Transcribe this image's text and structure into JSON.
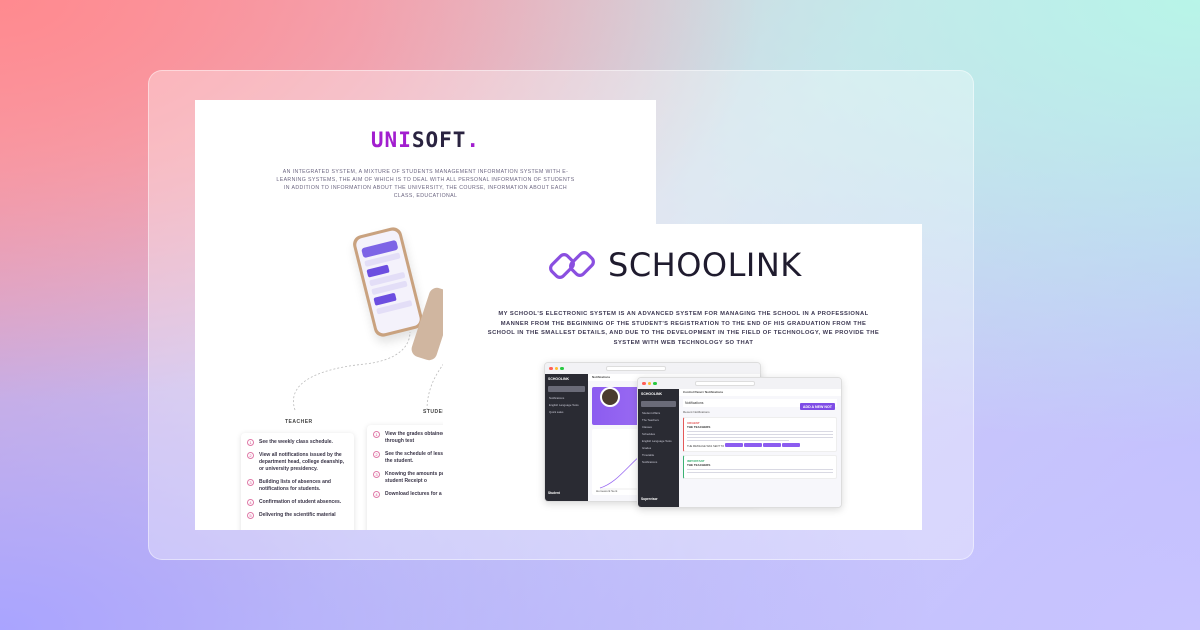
{
  "unisoft": {
    "logo_uni": "UNI",
    "logo_soft": "SOFT",
    "logo_dot": ".",
    "description": "An integrated system, a mixture of students management information system with e-learning systems, the aim of which is to deal with all personal information of students in addition to information about the university, the course, information about each class, educational",
    "teacher_label": "TEACHER",
    "student_label": "STUDENT",
    "teacher_items": [
      "See the weekly class schedule.",
      "View all notifications issued by the department head, college deanship, or university presidency.",
      "Building lists of absences and notifications for students.",
      "Confirmation of student absences.",
      "Delivering the scientific material"
    ],
    "student_items": [
      "View the grades obtained in evaluations through test",
      "See the schedule of lessons belong to the student.",
      "Knowing the amounts paid by the student Receipt o",
      "Download lectures for a"
    ]
  },
  "schoolink": {
    "logo_text": "SCHOOLINK",
    "description": "My school's electronic system is an advanced system for managing the school in a professional manner from the beginning of the student's registration to the end of his graduation from the school in the smallest details, and due to the development in the field of technology, we provide the system with web technology so that",
    "win1": {
      "brand": "SCHOOLINK",
      "header": "Notifications",
      "side_items": [
        "Notifications",
        "English Language Tests",
        "Quick sales"
      ],
      "footer": "Student",
      "graph_label": "Homework Sent",
      "mini_label": "Learn Percentage"
    },
    "win2": {
      "brand": "SCHOOLINK",
      "breadcrumb": "Control Panel  /  Notifications",
      "section_title": "Notifications",
      "recent_label": "Recent Notifications",
      "new_button": "ADD A NEW NOT",
      "side_items": [
        "Student Affairs",
        "The Teachers",
        "Classes",
        "Schedules",
        "English Language Tests",
        "Grades",
        "Timetable",
        "Notifications"
      ],
      "footer": "Supervisor",
      "card1_tag": "URGENT",
      "card1_title": "THE TEACHERS",
      "send_label": "THE MESSAGE WAS SENT TO",
      "card2_tag": "IMPORTANT",
      "card2_title": "THE TEACHERS"
    }
  },
  "colors": {
    "accent_purple": "#7f4de6",
    "uni_magenta": "#a21ecf",
    "dark_sidebar": "#2a2b33"
  }
}
